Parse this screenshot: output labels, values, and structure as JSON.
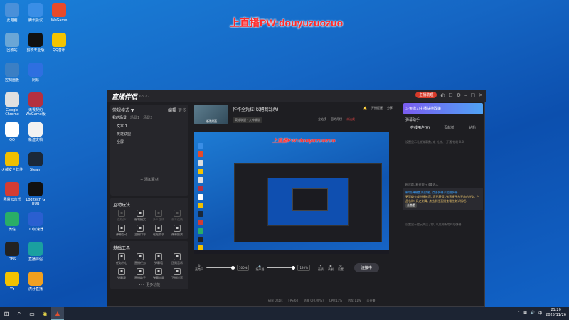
{
  "watermark": "上直播PW:douyuzuozuo",
  "desktop_icons": [
    {
      "label": "此电脑",
      "icon": "computer-icon",
      "color": "#4a90d9"
    },
    {
      "label": "腾讯会议",
      "icon": "meeting-icon",
      "color": "#3a8ee6"
    },
    {
      "label": "WeGame",
      "icon": "wegame-icon",
      "color": "#e84a2a"
    },
    {
      "label": "回收站",
      "icon": "recycle-bin-icon",
      "color": "#6aa6d6"
    },
    {
      "label": "剪映专业版",
      "icon": "capcut-icon",
      "color": "#111"
    },
    {
      "label": "QQ音乐",
      "icon": "qqmusic-icon",
      "color": "#f5c400"
    },
    {
      "label": "控制面板",
      "icon": "control-panel-icon",
      "color": "#3b7fc4"
    },
    {
      "label": "网易",
      "icon": "app-icon",
      "color": "#2e6fe0"
    },
    {
      "label": "Google Chrome",
      "icon": "chrome-icon",
      "color": "#e0e0e0"
    },
    {
      "label": "无畏契约 WeGame版",
      "icon": "valorant-icon",
      "color": "#b53040"
    },
    {
      "label": "QQ",
      "icon": "qq-icon",
      "color": "#ffffff"
    },
    {
      "label": "新建文档",
      "icon": "document-icon",
      "color": "#f2f2f2"
    },
    {
      "label": "火绒安全软件",
      "icon": "shield-icon",
      "color": "#f0c000"
    },
    {
      "label": "Steam",
      "icon": "steam-icon",
      "color": "#1b2838"
    },
    {
      "label": "网易云音乐",
      "icon": "netease-music-icon",
      "color": "#d43c33"
    },
    {
      "label": "Logitech G HUB",
      "icon": "logitech-icon",
      "color": "#111"
    },
    {
      "label": "微信",
      "icon": "wechat-icon",
      "color": "#2aae67"
    },
    {
      "label": "UU加速器",
      "icon": "uu-icon",
      "color": "#2a5fd0"
    },
    {
      "label": "OBS",
      "icon": "obs-icon",
      "color": "#222"
    },
    {
      "label": "直播伴侣",
      "icon": "stream-icon",
      "color": "#1aa0a0"
    },
    {
      "label": "YY",
      "icon": "yy-icon",
      "color": "#f3c200"
    },
    {
      "label": "虎牙直播",
      "icon": "huya-icon",
      "color": "#f0a020"
    }
  ],
  "app": {
    "name": "直播伴侣",
    "version": "6.5.2.3",
    "top_btn": "主播助理",
    "top_badge": "New"
  },
  "left": {
    "mode": "常规模式 ▼",
    "edit": "编辑",
    "more": "更多",
    "tabs": [
      "我的场景",
      "场景1",
      "场景2"
    ],
    "scenes": [
      "文本 1",
      "英雄联盟",
      "全屏"
    ],
    "add_source": "+ 添加素材",
    "interact_title": "互动玩法",
    "interact_tools": [
      {
        "label": "连线pk",
        "icon": "link-icon",
        "dim": true
      },
      {
        "label": "福利抽奖",
        "icon": "gift-icon",
        "dim": false
      },
      {
        "label": "多人连线",
        "icon": "users-icon",
        "dim": true
      },
      {
        "label": "观众连线",
        "icon": "user-icon",
        "dim": true
      },
      {
        "label": "弹幕互动",
        "icon": "download-icon",
        "dim": false
      },
      {
        "label": "主播口令",
        "icon": "chat-icon",
        "dim": false
      },
      {
        "label": "粘贴助手",
        "icon": "shield-icon",
        "dim": false
      },
      {
        "label": "弹幕投票",
        "icon": "edit-icon",
        "dim": false
      }
    ],
    "basic_title": "基础工具",
    "basic_tools": [
      {
        "label": "任务中心",
        "icon": "task-icon"
      },
      {
        "label": "直播任务",
        "icon": "badge-icon"
      },
      {
        "label": "弹幕墙",
        "icon": "wall-icon"
      },
      {
        "label": "正则音乐",
        "icon": "music-icon"
      },
      {
        "label": "弹幕表",
        "icon": "table-icon"
      },
      {
        "label": "直播助手",
        "icon": "assistant-icon"
      },
      {
        "label": "弹幕大屏",
        "icon": "screen-icon"
      },
      {
        "label": "下播设置",
        "icon": "settings-icon"
      }
    ],
    "more_tools": "••• 更多功能"
  },
  "center": {
    "cover_label": "修改封面",
    "title": "作作全凭拉!以把我乱杀!",
    "category": "英雄联盟 · 大神解说",
    "links": [
      "开播提醒",
      "分享"
    ],
    "status": [
      "全站榜",
      "您的月榜",
      "未达成"
    ],
    "mic_label": "麦克风",
    "mic_pct": "100%",
    "speaker_label": "扬声器",
    "speaker_pct": "120%",
    "actions": [
      "画质",
      "录制",
      "设置"
    ],
    "live_button": "连接中",
    "stats": [
      "码率 0Kb/s",
      "FPS:60",
      "丢帧 0(0.00%)",
      "CPU:11%",
      "内存:11%",
      "未开播"
    ]
  },
  "right": {
    "banner": "斗鱼潜力主播扶持政策",
    "title": "弹幕助手",
    "tabs": [
      "在线用户(0)",
      "贡献榜",
      "钻粉"
    ],
    "note": "设置显示礼物弹幕数, 来 礼物、 开通 钻粉 0.0",
    "notice_head": "粉丝群, 粉丝排行 4重选人",
    "notice_text": "新增[弹幕置顶]功能, 点击弹幕添加进弹幕",
    "notice2": "更等级完成主播推荐, 您已获得1张直播平台开放的任务, 产品名称: 风之剑舞, 点击前往直播查看任务详情吧.",
    "notice_btn": "去查看",
    "bottom_note": "设置显示提示关注了你, 以及刷新用户的弹幕"
  },
  "taskbar": {
    "time": "21:20",
    "date": "2025/11/26"
  }
}
